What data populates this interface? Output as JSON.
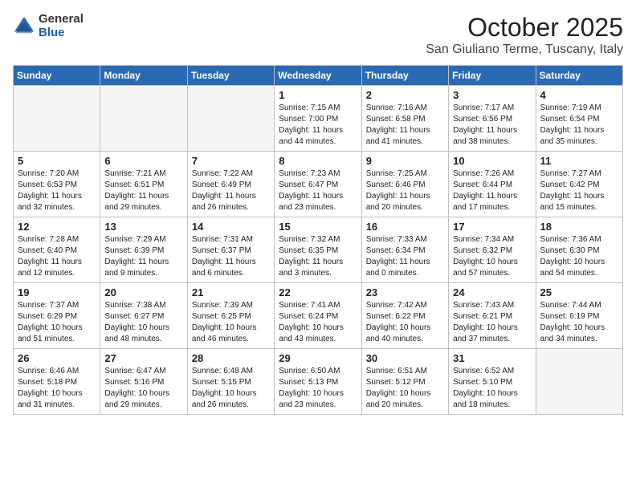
{
  "header": {
    "logo_general": "General",
    "logo_blue": "Blue",
    "month": "October 2025",
    "location": "San Giuliano Terme, Tuscany, Italy"
  },
  "days_of_week": [
    "Sunday",
    "Monday",
    "Tuesday",
    "Wednesday",
    "Thursday",
    "Friday",
    "Saturday"
  ],
  "weeks": [
    [
      {
        "day": "",
        "info": ""
      },
      {
        "day": "",
        "info": ""
      },
      {
        "day": "",
        "info": ""
      },
      {
        "day": "1",
        "info": "Sunrise: 7:15 AM\nSunset: 7:00 PM\nDaylight: 11 hours\nand 44 minutes."
      },
      {
        "day": "2",
        "info": "Sunrise: 7:16 AM\nSunset: 6:58 PM\nDaylight: 11 hours\nand 41 minutes."
      },
      {
        "day": "3",
        "info": "Sunrise: 7:17 AM\nSunset: 6:56 PM\nDaylight: 11 hours\nand 38 minutes."
      },
      {
        "day": "4",
        "info": "Sunrise: 7:19 AM\nSunset: 6:54 PM\nDaylight: 11 hours\nand 35 minutes."
      }
    ],
    [
      {
        "day": "5",
        "info": "Sunrise: 7:20 AM\nSunset: 6:53 PM\nDaylight: 11 hours\nand 32 minutes."
      },
      {
        "day": "6",
        "info": "Sunrise: 7:21 AM\nSunset: 6:51 PM\nDaylight: 11 hours\nand 29 minutes."
      },
      {
        "day": "7",
        "info": "Sunrise: 7:22 AM\nSunset: 6:49 PM\nDaylight: 11 hours\nand 26 minutes."
      },
      {
        "day": "8",
        "info": "Sunrise: 7:23 AM\nSunset: 6:47 PM\nDaylight: 11 hours\nand 23 minutes."
      },
      {
        "day": "9",
        "info": "Sunrise: 7:25 AM\nSunset: 6:46 PM\nDaylight: 11 hours\nand 20 minutes."
      },
      {
        "day": "10",
        "info": "Sunrise: 7:26 AM\nSunset: 6:44 PM\nDaylight: 11 hours\nand 17 minutes."
      },
      {
        "day": "11",
        "info": "Sunrise: 7:27 AM\nSunset: 6:42 PM\nDaylight: 11 hours\nand 15 minutes."
      }
    ],
    [
      {
        "day": "12",
        "info": "Sunrise: 7:28 AM\nSunset: 6:40 PM\nDaylight: 11 hours\nand 12 minutes."
      },
      {
        "day": "13",
        "info": "Sunrise: 7:29 AM\nSunset: 6:39 PM\nDaylight: 11 hours\nand 9 minutes."
      },
      {
        "day": "14",
        "info": "Sunrise: 7:31 AM\nSunset: 6:37 PM\nDaylight: 11 hours\nand 6 minutes."
      },
      {
        "day": "15",
        "info": "Sunrise: 7:32 AM\nSunset: 6:35 PM\nDaylight: 11 hours\nand 3 minutes."
      },
      {
        "day": "16",
        "info": "Sunrise: 7:33 AM\nSunset: 6:34 PM\nDaylight: 11 hours\nand 0 minutes."
      },
      {
        "day": "17",
        "info": "Sunrise: 7:34 AM\nSunset: 6:32 PM\nDaylight: 10 hours\nand 57 minutes."
      },
      {
        "day": "18",
        "info": "Sunrise: 7:36 AM\nSunset: 6:30 PM\nDaylight: 10 hours\nand 54 minutes."
      }
    ],
    [
      {
        "day": "19",
        "info": "Sunrise: 7:37 AM\nSunset: 6:29 PM\nDaylight: 10 hours\nand 51 minutes."
      },
      {
        "day": "20",
        "info": "Sunrise: 7:38 AM\nSunset: 6:27 PM\nDaylight: 10 hours\nand 48 minutes."
      },
      {
        "day": "21",
        "info": "Sunrise: 7:39 AM\nSunset: 6:25 PM\nDaylight: 10 hours\nand 46 minutes."
      },
      {
        "day": "22",
        "info": "Sunrise: 7:41 AM\nSunset: 6:24 PM\nDaylight: 10 hours\nand 43 minutes."
      },
      {
        "day": "23",
        "info": "Sunrise: 7:42 AM\nSunset: 6:22 PM\nDaylight: 10 hours\nand 40 minutes."
      },
      {
        "day": "24",
        "info": "Sunrise: 7:43 AM\nSunset: 6:21 PM\nDaylight: 10 hours\nand 37 minutes."
      },
      {
        "day": "25",
        "info": "Sunrise: 7:44 AM\nSunset: 6:19 PM\nDaylight: 10 hours\nand 34 minutes."
      }
    ],
    [
      {
        "day": "26",
        "info": "Sunrise: 6:46 AM\nSunset: 5:18 PM\nDaylight: 10 hours\nand 31 minutes."
      },
      {
        "day": "27",
        "info": "Sunrise: 6:47 AM\nSunset: 5:16 PM\nDaylight: 10 hours\nand 29 minutes."
      },
      {
        "day": "28",
        "info": "Sunrise: 6:48 AM\nSunset: 5:15 PM\nDaylight: 10 hours\nand 26 minutes."
      },
      {
        "day": "29",
        "info": "Sunrise: 6:50 AM\nSunset: 5:13 PM\nDaylight: 10 hours\nand 23 minutes."
      },
      {
        "day": "30",
        "info": "Sunrise: 6:51 AM\nSunset: 5:12 PM\nDaylight: 10 hours\nand 20 minutes."
      },
      {
        "day": "31",
        "info": "Sunrise: 6:52 AM\nSunset: 5:10 PM\nDaylight: 10 hours\nand 18 minutes."
      },
      {
        "day": "",
        "info": ""
      }
    ]
  ]
}
